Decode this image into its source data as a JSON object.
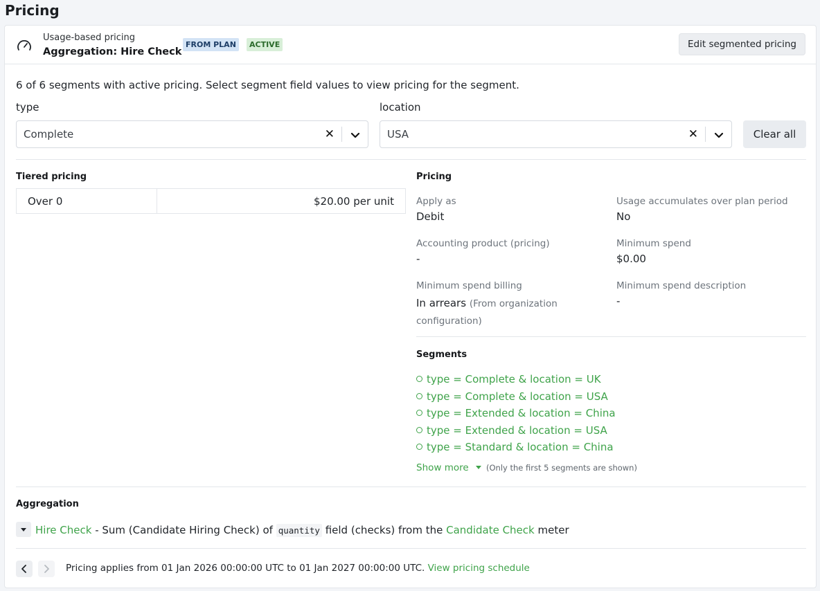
{
  "page": {
    "title": "Pricing"
  },
  "header": {
    "subtitle": "Usage-based pricing",
    "title": "Aggregation: Hire Check",
    "badges": {
      "plan": "FROM PLAN",
      "status": "ACTIVE"
    },
    "edit_button": "Edit segmented pricing",
    "icon": "gauge-icon"
  },
  "segment_filter": {
    "summary": "6 of 6 segments with active pricing. Select segment field values to view pricing for the segment.",
    "type": {
      "label": "type",
      "value": "Complete"
    },
    "location": {
      "label": "location",
      "value": "USA"
    },
    "clear_button": "Clear all"
  },
  "tiered_pricing": {
    "title": "Tiered pricing",
    "tiers": [
      {
        "range": "Over 0",
        "price": "$20.00 per unit"
      }
    ]
  },
  "pricing": {
    "title": "Pricing",
    "fields": {
      "apply_as": {
        "label": "Apply as",
        "value": "Debit"
      },
      "usage_accumulates": {
        "label": "Usage accumulates over plan period",
        "value": "No"
      },
      "accounting_product": {
        "label": "Accounting product (pricing)",
        "value": "-"
      },
      "minimum_spend": {
        "label": "Minimum spend",
        "value": "$0.00"
      },
      "min_spend_billing": {
        "label": "Minimum spend billing",
        "value": "In arrears",
        "note": "(From organization configuration)"
      },
      "min_spend_description": {
        "label": "Minimum spend description",
        "value": "-"
      }
    }
  },
  "segments": {
    "title": "Segments",
    "items": [
      "type = Complete & location = UK",
      "type = Complete & location = USA",
      "type = Extended & location = China",
      "type = Extended & location = USA",
      "type = Standard & location = China"
    ],
    "show_more": "Show more",
    "note": "(Only the first 5 segments are shown)"
  },
  "aggregation": {
    "title": "Aggregation",
    "name": "Hire Check",
    "text_1": "- Sum (Candidate Hiring Check) of",
    "field": "quantity",
    "text_2": "field (checks) from the",
    "meter": "Candidate Check",
    "text_3": "meter"
  },
  "footer": {
    "text": "Pricing applies from 01 Jan 2026 00:00:00 UTC to 01 Jan 2027 00:00:00 UTC.",
    "link": "View pricing schedule"
  },
  "colors": {
    "link": "#3fa34a",
    "badge_plan_bg": "#d3e3f5",
    "badge_active_bg": "#d8efd8"
  }
}
